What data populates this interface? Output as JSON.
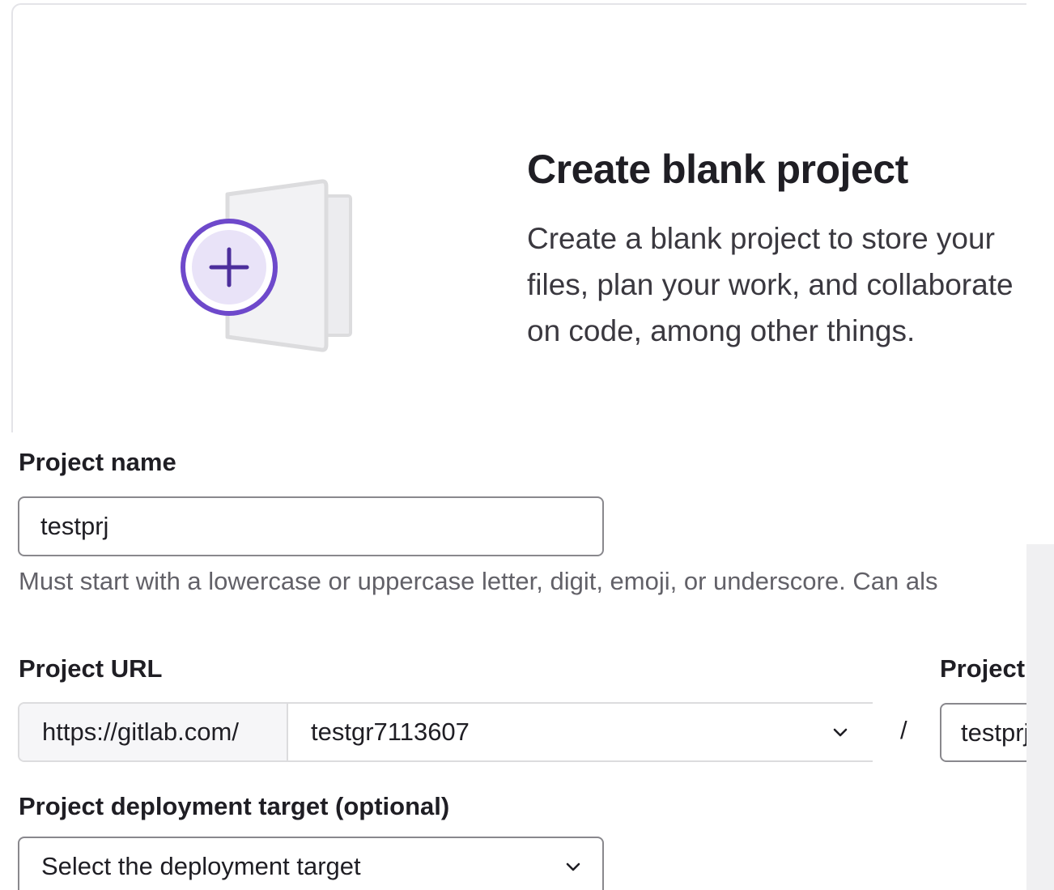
{
  "card": {
    "title": "Create blank project",
    "description": "Create a blank project to store your files, plan your work, and collaborate on code, among other things.",
    "illustration_icon": "plus-icon",
    "accent_color": "#6e49cb"
  },
  "project_name": {
    "label": "Project name",
    "value": "testprj",
    "help": "Must start with a lowercase or uppercase letter, digit, emoji, or underscore. Can als"
  },
  "project_url": {
    "label": "Project URL",
    "prefix": "https://gitlab.com/",
    "namespace": "testgr7113607",
    "separator": "/"
  },
  "project_slug": {
    "label": "Project",
    "value": "testprj"
  },
  "deployment": {
    "label": "Project deployment target (optional)",
    "placeholder": "Select the deployment target"
  },
  "icons": {
    "dropdown": "chevron-down-icon"
  }
}
